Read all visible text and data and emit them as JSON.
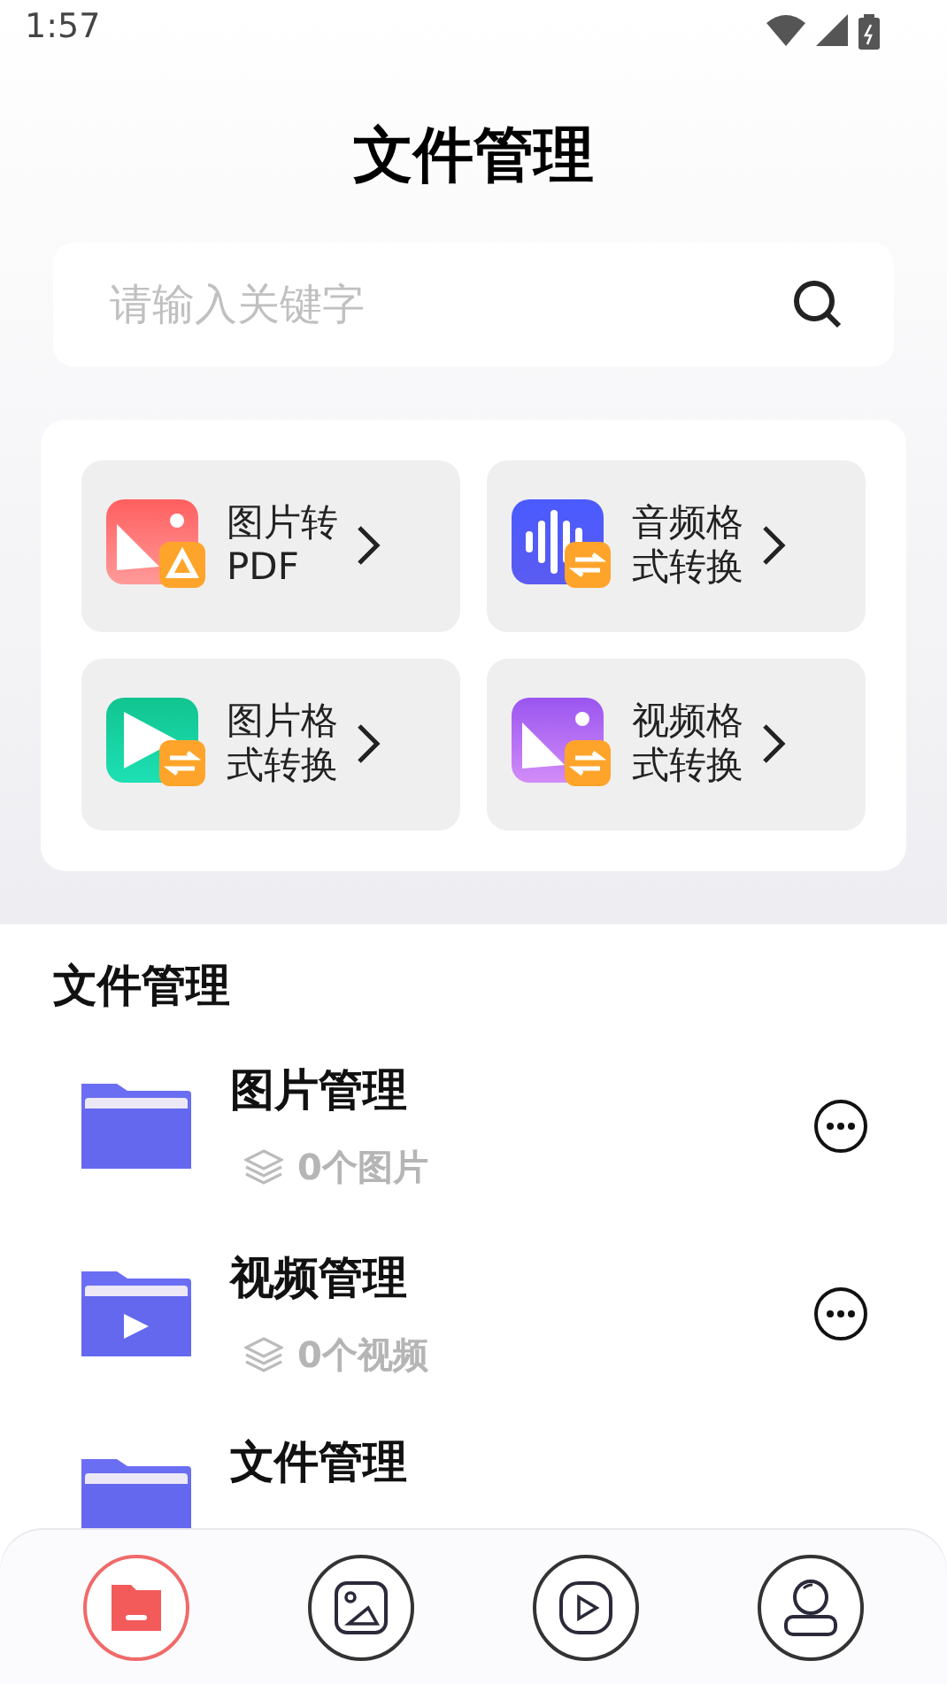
{
  "status_bar": {
    "time": "1:57"
  },
  "header": {
    "title": "文件管理"
  },
  "search": {
    "placeholder": "请输入关键字"
  },
  "tools": [
    {
      "kind": "pdf",
      "label": "图片转PDF"
    },
    {
      "kind": "audio",
      "label": "音频格式转换"
    },
    {
      "kind": "image",
      "label": "图片格式转换"
    },
    {
      "kind": "video",
      "label": "视频格式转换"
    }
  ],
  "section": {
    "title": "文件管理"
  },
  "folders": [
    {
      "kind": "image",
      "name": "图片管理",
      "count": "0个图片"
    },
    {
      "kind": "video",
      "name": "视频管理",
      "count": "0个视频"
    },
    {
      "kind": "file",
      "name": "文件管理"
    }
  ],
  "nav": [
    {
      "kind": "files",
      "selected": true
    },
    {
      "kind": "image",
      "selected": false
    },
    {
      "kind": "video",
      "selected": false
    },
    {
      "kind": "profile",
      "selected": false
    }
  ]
}
